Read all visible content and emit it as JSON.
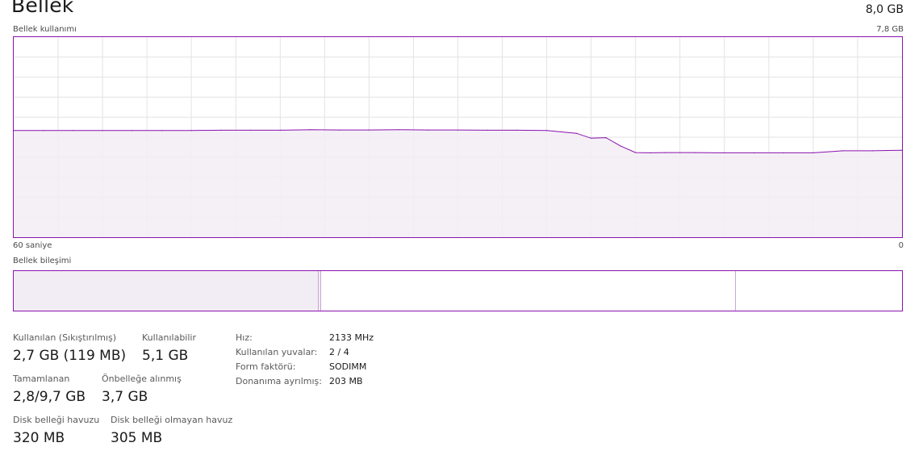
{
  "header": {
    "title": "Bellek",
    "total": "8,0 GB"
  },
  "usage_graph": {
    "label": "Bellek kullanımı",
    "max_label": "7,8 GB",
    "left_axis_label": "60 saniye",
    "right_axis_label": "0",
    "line_color": "#8b12ae",
    "fill_color": "#f2edf4",
    "grid_color": "#e3e3e3",
    "chart_data": {
      "type": "area",
      "title": "",
      "xlabel": "",
      "ylabel": "",
      "x": [
        60,
        58,
        56,
        54,
        52,
        50,
        48,
        46,
        44,
        42,
        40,
        38,
        36,
        34,
        32,
        30,
        28,
        26,
        24,
        22,
        21,
        20,
        19,
        18,
        17,
        16,
        15,
        14,
        12,
        10,
        8,
        6,
        4,
        2,
        1,
        0
      ],
      "values": [
        4.16,
        4.16,
        4.16,
        4.16,
        4.16,
        4.16,
        4.16,
        4.17,
        4.17,
        4.17,
        4.19,
        4.18,
        4.18,
        4.19,
        4.18,
        4.18,
        4.17,
        4.17,
        4.16,
        4.05,
        3.86,
        3.88,
        3.55,
        3.3,
        3.29,
        3.3,
        3.3,
        3.3,
        3.29,
        3.29,
        3.29,
        3.29,
        3.37,
        3.37,
        3.38,
        3.39
      ],
      "xlim": [
        60,
        0
      ],
      "ylim": [
        0,
        7.8
      ],
      "grid": true
    }
  },
  "composition": {
    "label": "Bellek bileşimi"
  },
  "stats": {
    "in_use_label": "Kullanılan (Sıkıştırılmış)",
    "in_use_value": "2,7 GB (119 MB)",
    "available_label": "Kullanılabilir",
    "available_value": "5,1 GB",
    "committed_label": "Tamamlanan",
    "committed_value": "2,8/9,7 GB",
    "cached_label": "Önbelleğe alınmış",
    "cached_value": "3,7 GB",
    "paged_pool_label": "Disk belleği havuzu",
    "paged_pool_value": "320 MB",
    "nonpaged_pool_label": "Disk belleği olmayan havuz",
    "nonpaged_pool_value": "305 MB"
  },
  "specs": {
    "speed_label": "Hız:",
    "speed_value": "2133 MHz",
    "slots_label": "Kullanılan yuvalar:",
    "slots_value": "2 / 4",
    "form_label": "Form faktörü:",
    "form_value": "SODIMM",
    "reserved_label": "Donanıma ayrılmış:",
    "reserved_value": "203 MB"
  }
}
